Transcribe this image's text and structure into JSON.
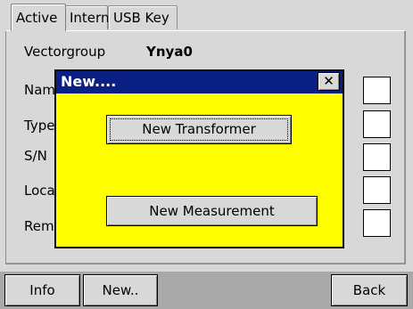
{
  "tabs": [
    {
      "label": "Active"
    },
    {
      "label": "Intern"
    },
    {
      "label": "USB Key"
    }
  ],
  "fields": {
    "vectorgroup": {
      "label": "Vectorgroup",
      "value": "Ynya0"
    },
    "name": {
      "label": "Nam"
    },
    "type": {
      "label": "Type"
    },
    "sn": {
      "label": "S/N"
    },
    "location": {
      "label": "Loca"
    },
    "remark": {
      "label": "Rem"
    }
  },
  "dialog": {
    "title": "New....",
    "close_glyph": "✕",
    "new_transformer_label": "New Transformer",
    "new_measurement_label": "New Measurement",
    "body_color": "#ffff00",
    "title_color": "#0a1f83"
  },
  "toolbar": {
    "info_label": "Info",
    "new_label": "New..",
    "back_label": "Back"
  }
}
